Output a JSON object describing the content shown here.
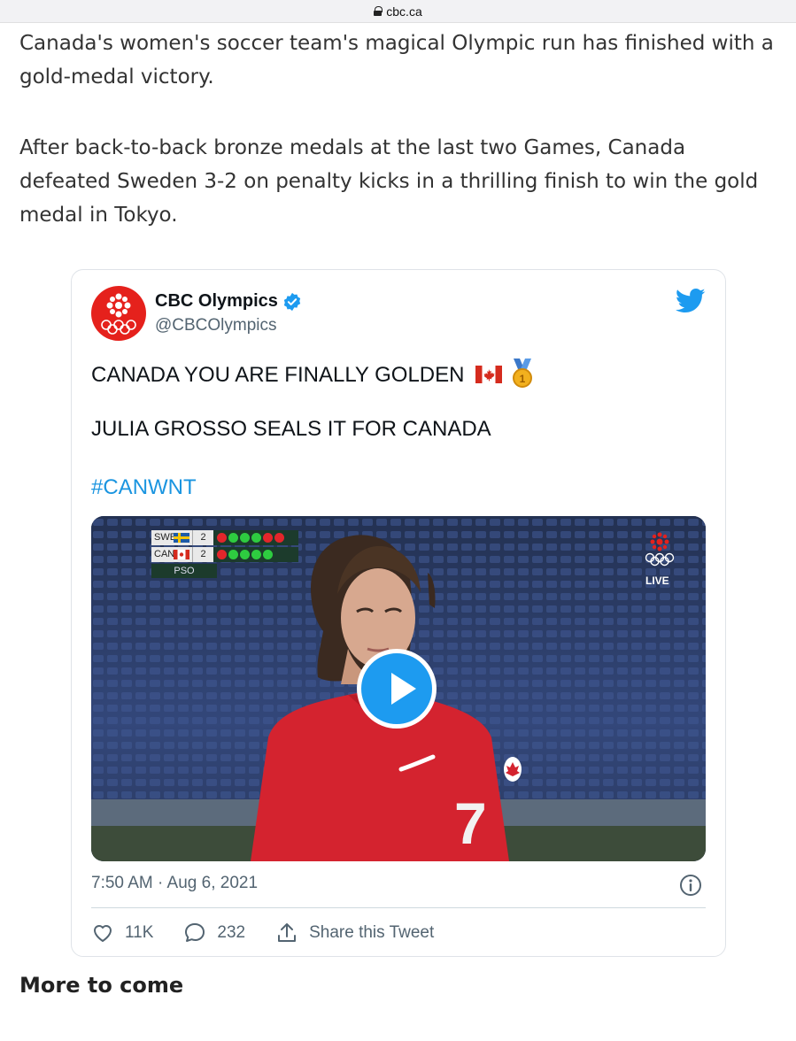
{
  "browser": {
    "domain": "cbc.ca"
  },
  "article": {
    "paragraph1": "Canada's women's soccer team's magical Olympic run has finished with a gold-medal victory.",
    "paragraph2": "After back-to-back bronze medals at the last two Games, Canada defeated Sweden 3-2 on penalty kicks in a thrilling finish to win the gold medal in Tokyo.",
    "subheading": "More to come"
  },
  "tweet": {
    "author_name": "CBC Olympics",
    "handle": "@CBCOlympics",
    "line1": "CANADA YOU ARE FINALLY GOLDEN",
    "line2": "JULIA GROSSO SEALS IT FOR CANADA",
    "hashtag": "#CANWNT",
    "timestamp": "7:50 AM · Aug 6, 2021",
    "likes": "11K",
    "replies": "232",
    "share_label": "Share this Tweet",
    "icons": [
      "verified-icon",
      "twitter-bird-icon",
      "canada-flag-emoji",
      "gold-medal-emoji",
      "info-icon",
      "heart-icon",
      "reply-icon",
      "share-icon"
    ]
  },
  "video": {
    "scoreboard": {
      "rows": [
        {
          "team": "SWE",
          "score": "2",
          "kicks": [
            "miss",
            "goal",
            "goal",
            "goal",
            "miss",
            "miss"
          ]
        },
        {
          "team": "CAN",
          "score": "2",
          "kicks": [
            "miss",
            "goal",
            "goal",
            "goal",
            "goal"
          ]
        }
      ],
      "status": "PSO"
    },
    "broadcast_label": "LIVE",
    "jersey_number": "7"
  },
  "colors": {
    "twitter_blue": "#1d9bf0",
    "cbc_red": "#e5211c",
    "kick_goal": "#2ecc40",
    "kick_miss": "#e3262b"
  }
}
